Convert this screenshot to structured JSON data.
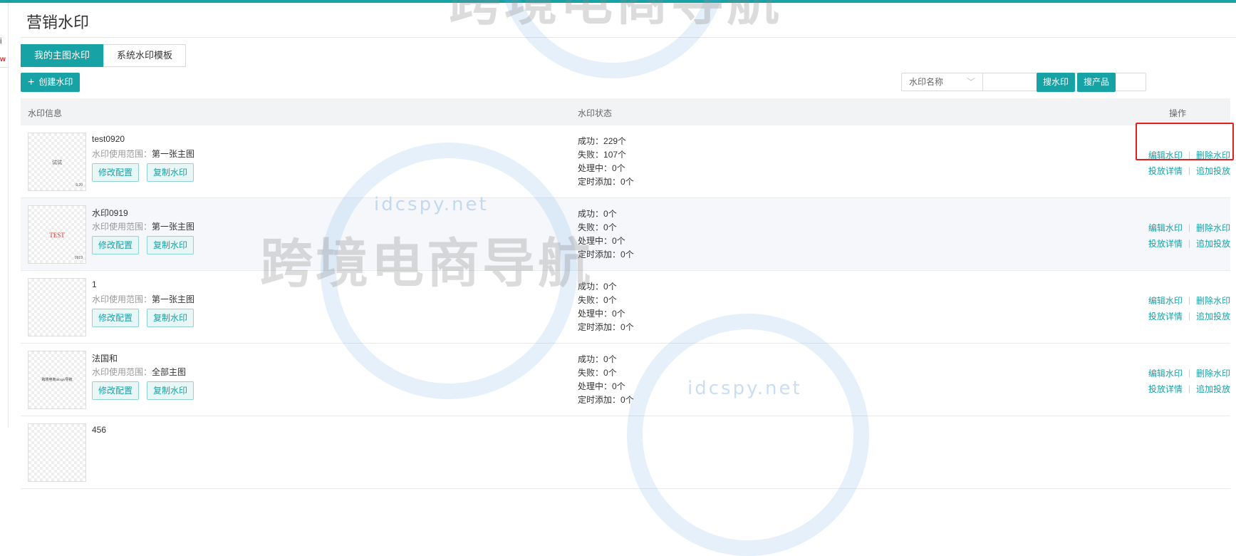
{
  "page": {
    "title": "营销水印"
  },
  "sidebar": {
    "frag1": "i",
    "frag2": "w"
  },
  "tabs": [
    {
      "label": "我的主图水印"
    },
    {
      "label": "系统水印模板"
    }
  ],
  "toolbar": {
    "create_label": "创建水印",
    "select_value": "水印名称",
    "search_value": "",
    "search_watermark_label": "搜水印",
    "search_product_label": "搜产品"
  },
  "table": {
    "headers": {
      "info": "水印信息",
      "status": "水印状态",
      "ops": "操作"
    },
    "scope_label": "水印使用范围：",
    "btn_modify": "修改配置",
    "btn_copy": "复制水印",
    "status_labels": {
      "success": "成功：",
      "fail": "失败：",
      "processing": "处理中：",
      "scheduled": "定时添加："
    },
    "ops_labels": {
      "edit": "编辑水印",
      "delete": "删除水印",
      "detail": "投放详情",
      "add": "追加投放"
    },
    "rows": [
      {
        "name": "test0920",
        "scope": "第一张主图",
        "thumb_text": "试试",
        "thumb_corner": "9.20",
        "success": "229个",
        "fail": "107个",
        "processing": "0个",
        "scheduled": "0个"
      },
      {
        "name": "水印0919",
        "scope": "第一张主图",
        "thumb_text": "TEST",
        "thumb_corner": "0919",
        "success": "0个",
        "fail": "0个",
        "processing": "0个",
        "scheduled": "0个"
      },
      {
        "name": "1",
        "scope": "第一张主图",
        "thumb_text": "",
        "thumb_corner": "",
        "success": "0个",
        "fail": "0个",
        "processing": "0个",
        "scheduled": "0个"
      },
      {
        "name": "法国和",
        "scope": "全部主图",
        "thumb_text": "跨境电商idcspy导航",
        "thumb_corner": "",
        "success": "0个",
        "fail": "0个",
        "processing": "0个",
        "scheduled": "0个"
      },
      {
        "name": "456",
        "scope": "",
        "thumb_text": "",
        "thumb_corner": "",
        "success": "",
        "fail": "",
        "processing": "",
        "scheduled": ""
      }
    ]
  },
  "watermark": {
    "text": "跨境电商导航",
    "domain": "idcspy.net"
  },
  "colors": {
    "accent": "#17a2a6",
    "highlight": "#e02020",
    "header_bg": "#f2f3f5"
  }
}
